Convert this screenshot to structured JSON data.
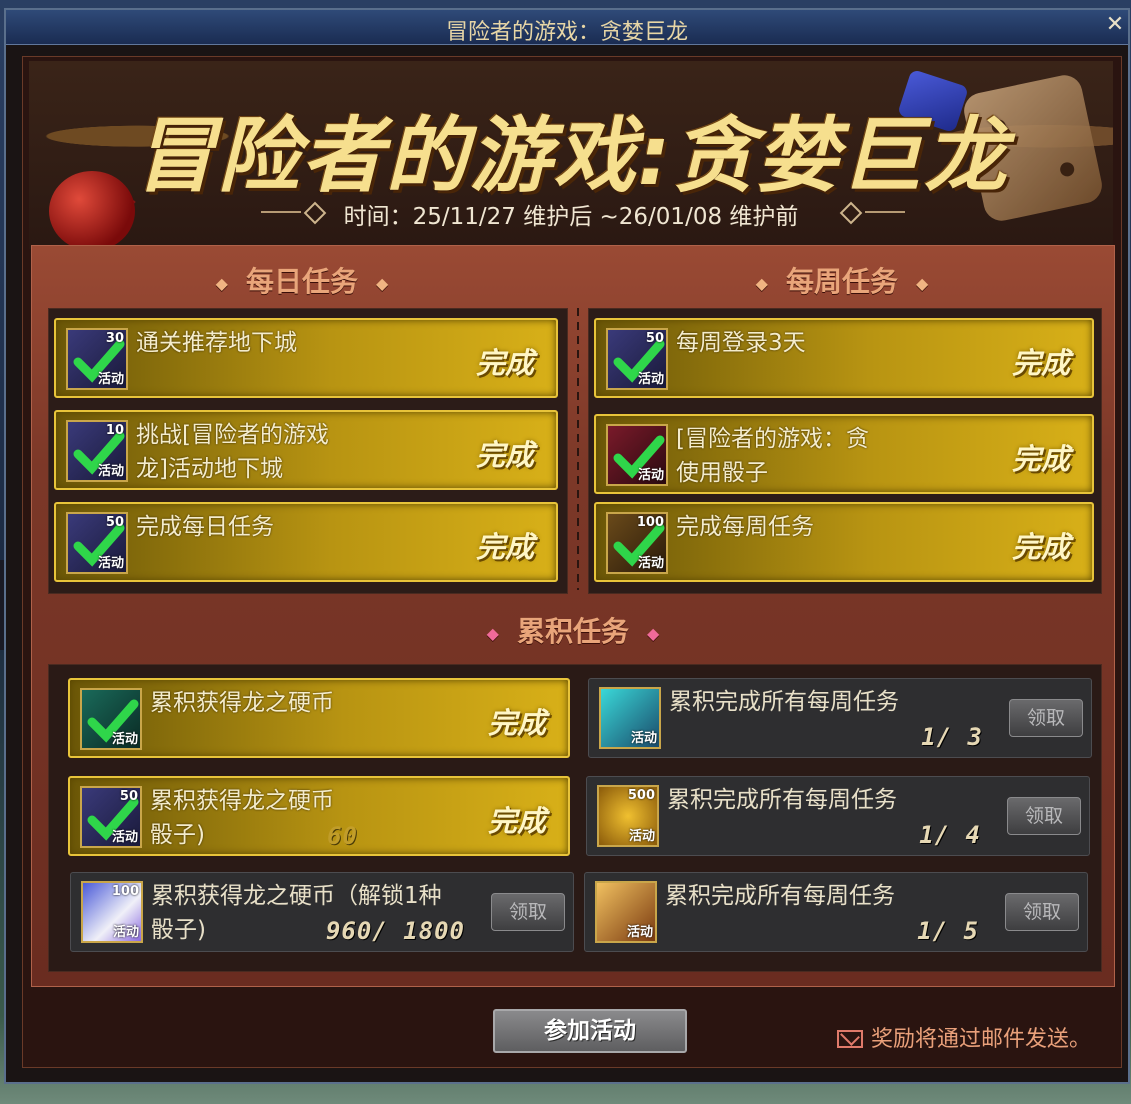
{
  "window": {
    "title": "冒险者的游戏：贪婪巨龙",
    "close_glyph": "✕"
  },
  "banner": {
    "title": "冒险者的游戏:贪婪巨龙",
    "time": "时间：25/11/27 维护后 ~26/01/08 维护前"
  },
  "daily": {
    "heading": "每日任务",
    "tasks": [
      {
        "name": "通关推荐地下城",
        "qty": "30",
        "badge": "活动",
        "status": "完成"
      },
      {
        "name": "挑战[冒险者的游戏\n龙]活动地下城",
        "qty": "10",
        "badge": "活动",
        "status": "完成"
      },
      {
        "name": "完成每日任务",
        "qty": "50",
        "badge": "活动",
        "status": "完成"
      }
    ]
  },
  "weekly": {
    "heading": "每周任务",
    "tasks": [
      {
        "name": "每周登录3天",
        "qty": "50",
        "badge": "活动",
        "status": "完成"
      },
      {
        "name": "[冒险者的游戏：贪\n使用骰子",
        "qty": "",
        "badge": "活动",
        "status": "完成"
      },
      {
        "name": "完成每周任务",
        "qty": "100",
        "badge": "活动",
        "status": "完成"
      }
    ]
  },
  "cumulative": {
    "heading": "累积任务",
    "left": [
      {
        "name": "累积获得龙之硬币",
        "qty": "",
        "badge": "活动",
        "status": "完成"
      },
      {
        "name": "累积获得龙之硬币\n骰子)",
        "qty": "50",
        "badge": "活动",
        "status": "完成",
        "faded": "60"
      },
      {
        "name": "累积获得龙之硬币（解锁1种\n骰子)",
        "qty": "100",
        "badge": "活动",
        "progress": "960/ 1800",
        "claim": "领取"
      }
    ],
    "right": [
      {
        "name": "累积完成所有每周任务",
        "qty": "",
        "badge": "活动",
        "progress": "1/ 3",
        "claim": "领取"
      },
      {
        "name": "累积完成所有每周任务",
        "qty": "500",
        "badge": "活动",
        "progress": "1/ 4",
        "claim": "领取"
      },
      {
        "name": "累积完成所有每周任务",
        "qty": "",
        "badge": "活动",
        "progress": "1/ 5",
        "claim": "领取"
      }
    ]
  },
  "footer": {
    "join_label": "参加活动",
    "mail_note": "奖励将通过邮件发送。"
  },
  "colors": {
    "done_gold": "#d8b018",
    "heading_salmon": "#e9a57a",
    "check_green": "#2fd64a"
  }
}
